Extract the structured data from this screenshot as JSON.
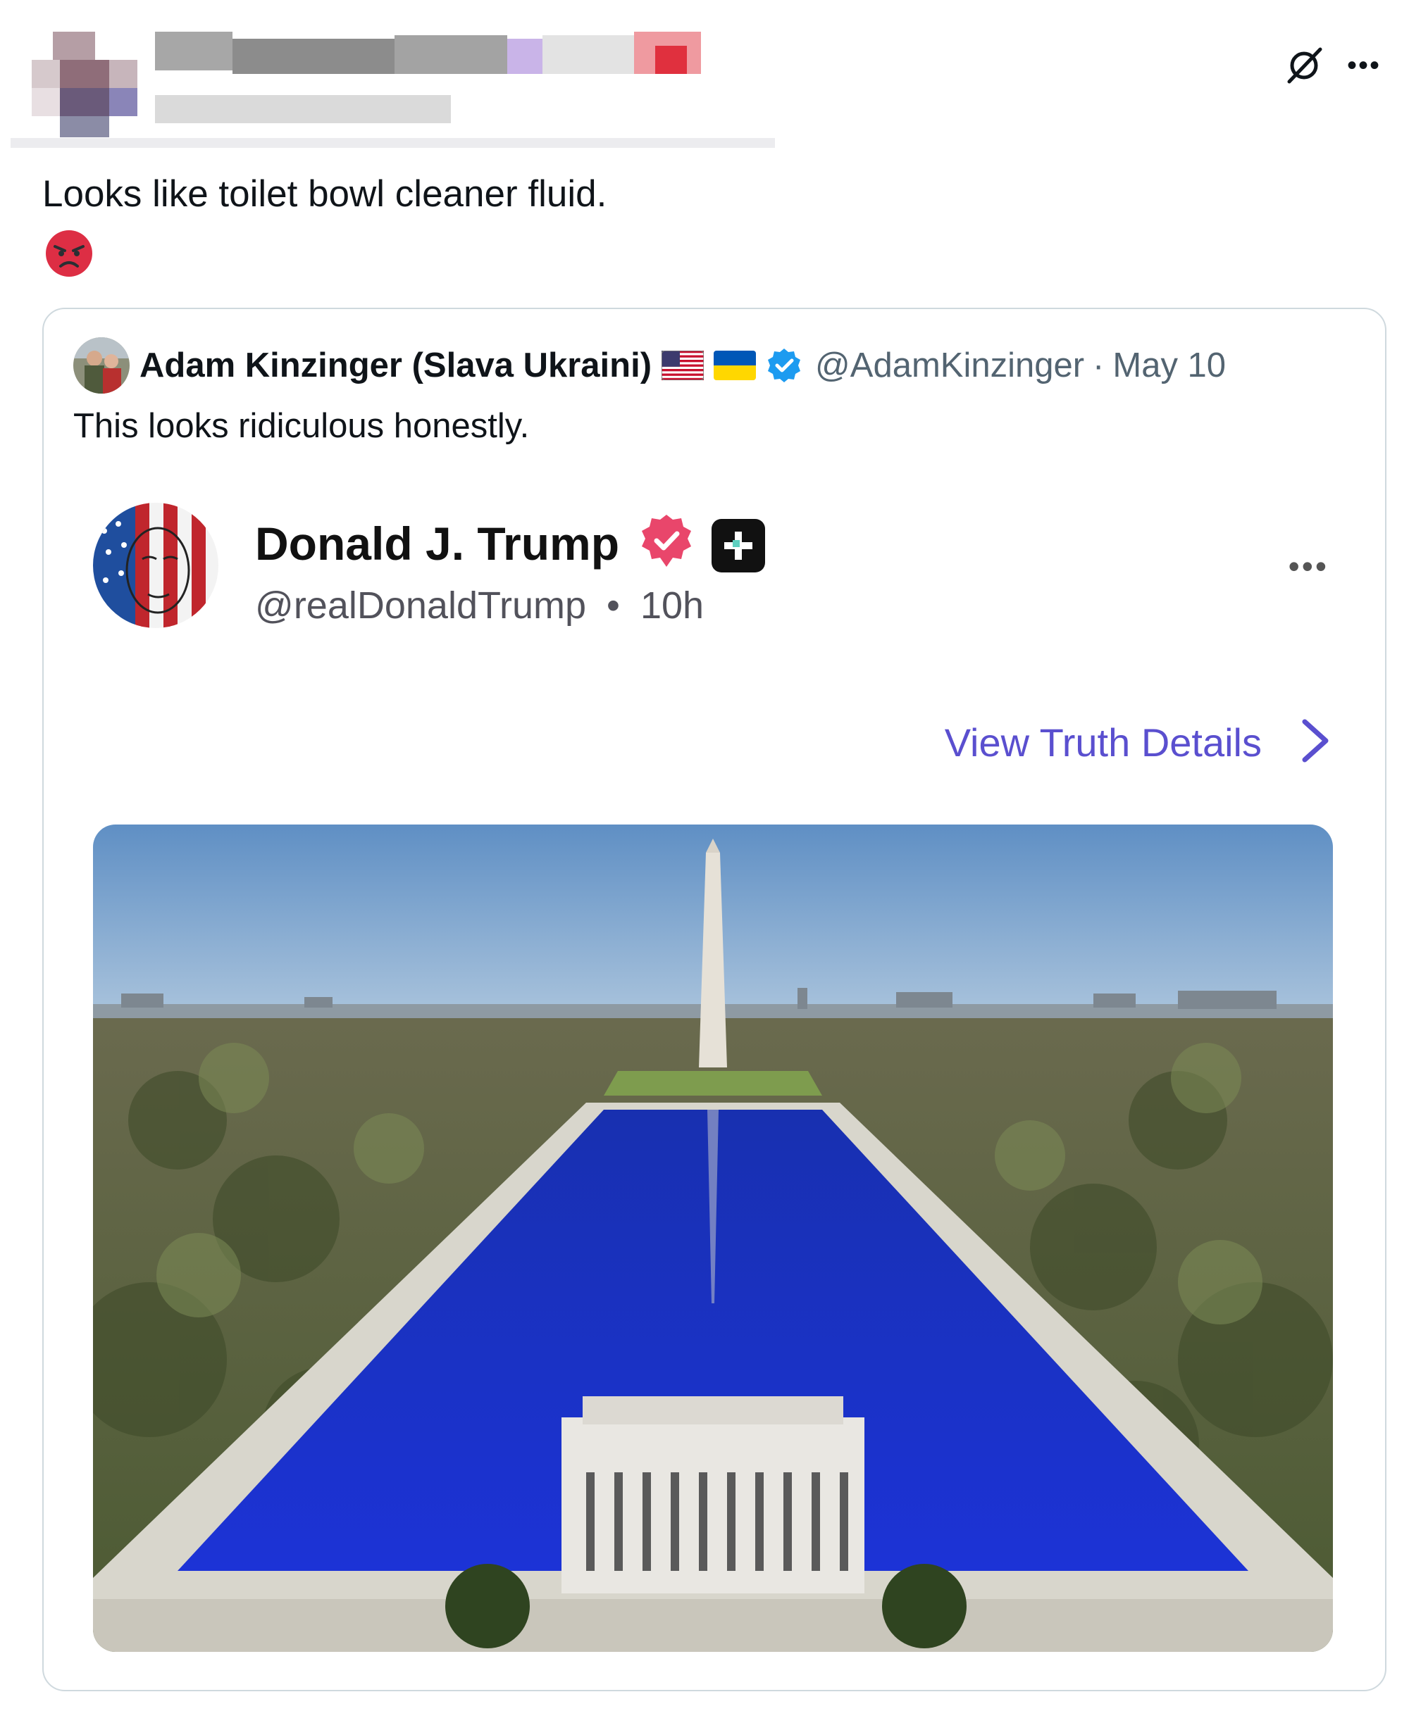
{
  "outer_tweet": {
    "text": "Looks like toilet bowl cleaner fluid.",
    "emoji": "angry-face"
  },
  "quoted_tweet": {
    "author_name": "Adam Kinzinger (Slava Ukraini)",
    "flags": [
      "us-flag",
      "ukraine-flag"
    ],
    "verified": true,
    "handle": "@AdamKinzinger",
    "separator": "·",
    "date": "May 10",
    "text": "This looks ridiculous honestly."
  },
  "embedded_post": {
    "author_name": "Donald J. Trump",
    "handle": "@realDonaldTrump",
    "separator": "•",
    "time": "10h",
    "more": "•••",
    "details_link": "View Truth Details"
  },
  "colors": {
    "link_purple": "#5a4fcf",
    "verified_blue": "#1d9bf0",
    "truth_badge_pink": "#e9466b",
    "pool_blue": "#1a2fd1"
  }
}
